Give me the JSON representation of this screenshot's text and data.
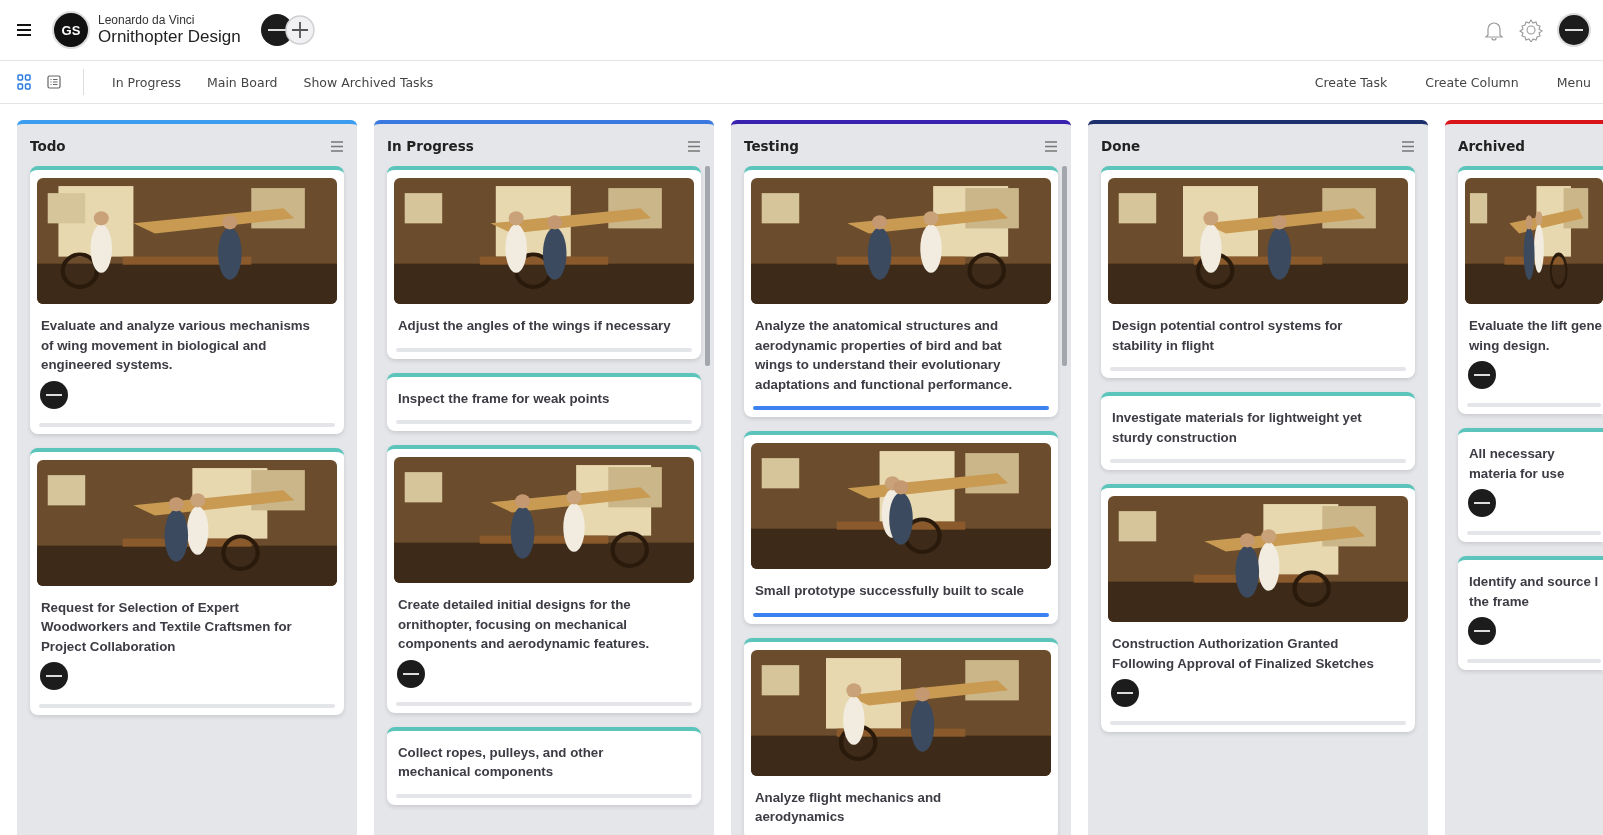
{
  "header": {
    "logo": "GS",
    "owner": "Leonardo da Vinci",
    "project": "Ornithopter Design"
  },
  "toolbar": {
    "views": [
      {
        "kind": "board",
        "selected": true
      },
      {
        "kind": "list",
        "selected": false
      }
    ],
    "links": [
      "In Progress",
      "Main Board",
      "Show Archived Tasks"
    ],
    "actions": [
      "Create Task",
      "Create Column",
      "Menu"
    ]
  },
  "columns": [
    {
      "title": "Todo",
      "color": "#3b9cf0",
      "menu": true,
      "scrollbar": false,
      "cards": [
        {
          "image": true,
          "title": "Evaluate and analyze various mechanisms of wing movement in biological and engineered systems.",
          "avatar": true,
          "level": 0
        },
        {
          "image": true,
          "title": "Request for Selection of Expert Woodworkers and Textile Craftsmen for Project Collaboration",
          "avatar": true,
          "level": 0
        }
      ]
    },
    {
      "title": "In Progress",
      "color": "#3b78e0",
      "menu": true,
      "scrollbar": true,
      "cards": [
        {
          "image": true,
          "title": "Adjust the angles of the wings if necessary",
          "avatar": false,
          "level": 0
        },
        {
          "image": false,
          "title": "Inspect the frame for weak points",
          "avatar": false,
          "level": 0
        },
        {
          "image": true,
          "title": "Create detailed initial designs for the ornithopter, focusing on mechanical components and aerodynamic features.",
          "avatar": true,
          "level": 0
        },
        {
          "image": false,
          "title": "Collect ropes, pulleys, and other mechanical components",
          "avatar": false,
          "level": 0
        }
      ]
    },
    {
      "title": "Testing",
      "color": "#3a22b0",
      "menu": true,
      "scrollbar": true,
      "cards": [
        {
          "image": true,
          "title": "Analyze the anatomical structures and aerodynamic properties of bird and bat wings to understand their evolutionary adaptations and functional performance.",
          "avatar": false,
          "level": 1
        },
        {
          "image": true,
          "title": "Small prototype successfully built to scale",
          "avatar": false,
          "level": 1
        },
        {
          "image": true,
          "title": "Analyze flight mechanics and aerodynamics",
          "avatar": false
        }
      ]
    },
    {
      "title": "Done",
      "color": "#1e2f6e",
      "menu": true,
      "scrollbar": false,
      "cards": [
        {
          "image": true,
          "title": "Design potential control systems for stability in flight",
          "avatar": false,
          "level": 0
        },
        {
          "image": false,
          "title": "Investigate materials for lightweight yet sturdy construction",
          "avatar": false,
          "level": 0
        },
        {
          "image": true,
          "title": "Construction Authorization Granted Following Approval of Finalized Sketches",
          "avatar": true,
          "level": 0
        }
      ]
    },
    {
      "title": "Archived",
      "color": "#d9141b",
      "menu": false,
      "scrollbar": false,
      "cards": [
        {
          "image": true,
          "title": "Evaluate the lift gene wing design.",
          "avatar": true,
          "level": 0
        },
        {
          "image": false,
          "title": "All necessary materia for use",
          "avatar": true,
          "level": 0
        },
        {
          "image": false,
          "title": "Identify and source l the frame",
          "avatar": true,
          "level": 0
        }
      ]
    }
  ]
}
